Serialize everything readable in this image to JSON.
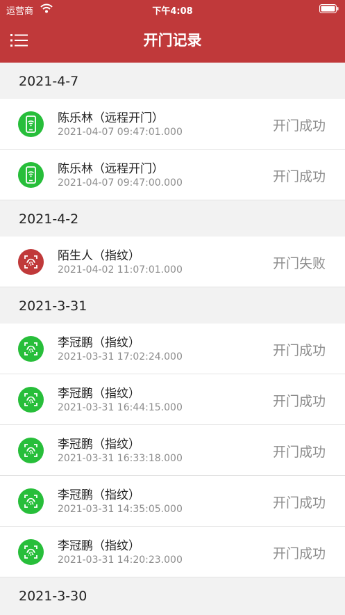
{
  "status_bar": {
    "carrier": "运营商",
    "time": "下午4:08"
  },
  "nav": {
    "title": "开门记录",
    "menu_icon": "list-menu-icon"
  },
  "colors": {
    "header": "#c0393a",
    "success": "#27be3a",
    "failure": "#c0393a"
  },
  "sections": [
    {
      "date": "2021-4-7",
      "records": [
        {
          "name": "陈乐林（远程开门）",
          "time": "2021-04-07 09:47:01.000",
          "status": "开门成功",
          "icon": "remote-phone-icon",
          "result": "success"
        },
        {
          "name": "陈乐林（远程开门）",
          "time": "2021-04-07 09:47:00.000",
          "status": "开门成功",
          "icon": "remote-phone-icon",
          "result": "success"
        }
      ]
    },
    {
      "date": "2021-4-2",
      "records": [
        {
          "name": "陌生人（指纹）",
          "time": "2021-04-02 11:07:01.000",
          "status": "开门失败",
          "icon": "fingerprint-icon",
          "result": "failure"
        }
      ]
    },
    {
      "date": "2021-3-31",
      "records": [
        {
          "name": "李冠鹏（指纹）",
          "time": "2021-03-31 17:02:24.000",
          "status": "开门成功",
          "icon": "fingerprint-icon",
          "result": "success"
        },
        {
          "name": "李冠鹏（指纹）",
          "time": "2021-03-31 16:44:15.000",
          "status": "开门成功",
          "icon": "fingerprint-icon",
          "result": "success"
        },
        {
          "name": "李冠鹏（指纹）",
          "time": "2021-03-31 16:33:18.000",
          "status": "开门成功",
          "icon": "fingerprint-icon",
          "result": "success"
        },
        {
          "name": "李冠鹏（指纹）",
          "time": "2021-03-31 14:35:05.000",
          "status": "开门成功",
          "icon": "fingerprint-icon",
          "result": "success"
        },
        {
          "name": "李冠鹏（指纹）",
          "time": "2021-03-31 14:20:23.000",
          "status": "开门成功",
          "icon": "fingerprint-icon",
          "result": "success"
        }
      ]
    },
    {
      "date": "2021-3-30",
      "records": []
    }
  ]
}
